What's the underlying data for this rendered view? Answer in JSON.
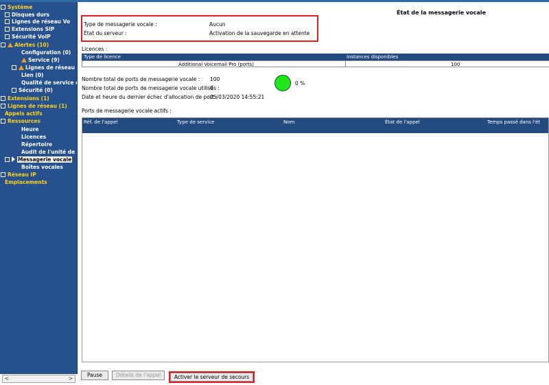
{
  "sidebar": {
    "items": [
      {
        "label": "Système",
        "color": "yellow",
        "expander": "minus"
      },
      {
        "label": "Disques durs",
        "color": "white",
        "expander": "plus"
      },
      {
        "label": "Lignes de réseau Vo",
        "color": "white",
        "expander": "plus"
      },
      {
        "label": "Extensions SIP",
        "color": "white",
        "expander": "plus"
      },
      {
        "label": "Sécurité VoIP",
        "color": "white",
        "expander": "plus"
      },
      {
        "label": "Alertes (10)",
        "color": "yellow",
        "expander": "minus",
        "icon": "warning-icon"
      },
      {
        "label": "Configuration (0)",
        "color": "white"
      },
      {
        "label": "Service (9)",
        "color": "white",
        "icon": "warning-icon"
      },
      {
        "label": "Lignes de réseau",
        "color": "white",
        "expander": "plus",
        "icon": "warning-icon"
      },
      {
        "label": "Lien (0)",
        "color": "white"
      },
      {
        "label": "Qualité de service de",
        "color": "white"
      },
      {
        "label": "Sécurité (0)",
        "color": "white",
        "expander": "plus"
      },
      {
        "label": "Extensions (1)",
        "color": "yellow",
        "expander": "plus"
      },
      {
        "label": "Lignes de réseau (1)",
        "color": "yellow",
        "expander": "plus"
      },
      {
        "label": "Appels actifs",
        "color": "yellow"
      },
      {
        "label": "Ressources",
        "color": "yellow",
        "expander": "minus"
      },
      {
        "label": "Heure",
        "color": "white"
      },
      {
        "label": "Licences",
        "color": "white"
      },
      {
        "label": "Répertoire",
        "color": "white"
      },
      {
        "label": "Audit de l'unité de c",
        "color": "white"
      },
      {
        "label": "Messagerie vocale",
        "color": "white",
        "expander": "minus",
        "selected": true,
        "icon": "arrow-icon"
      },
      {
        "label": "Boîtes vocales",
        "color": "white"
      },
      {
        "label": "Réseau IP",
        "color": "yellow",
        "expander": "plus"
      },
      {
        "label": "Emplacements",
        "color": "yellow"
      }
    ],
    "scroll_left": "<",
    "scroll_right": ">"
  },
  "main": {
    "title": "État de la messagerie vocale",
    "voicemail_type_label": "Type de messagerie vocale :",
    "voicemail_type_value": "Aucun",
    "server_state_label": "État du serveur :",
    "server_state_value": "Activation de la sauvegarde en attente",
    "licenses_label": "Licences :",
    "licenses_table": {
      "headers": [
        "Type de licence",
        "Instances disponibles"
      ],
      "rows": [
        [
          "Additional Voicemail Pro (ports)",
          "100"
        ]
      ]
    },
    "total_ports_label": "Nombre total de ports de messagerie vocale :",
    "total_ports_value": "100",
    "used_ports_label": "Nombre total de ports de messagerie vocale utilisés :",
    "used_ports_value": "0",
    "last_failure_label": "Date et heure du dernier échec d'allocation de port :",
    "last_failure_value": "25/03/2020 14:55:21",
    "usage_percent_text": "0 %",
    "usage_percent": 0,
    "active_ports_label": "Ports de messagerie vocale actifs :",
    "active_ports_headers": [
      "Réf. de l'appel",
      "Type de service",
      "Nom",
      "État de l'appel",
      "Temps passé dans l'ét"
    ],
    "active_ports_rows": []
  },
  "buttons": {
    "pause": "Pause",
    "call_details": "Détails de l'appel",
    "activate_backup": "Activer le serveur de secours"
  },
  "colors": {
    "sidebar_bg": "#26508e",
    "table_header_bg": "#244b7f",
    "highlight_red": "#e01b24",
    "gauge_green": "#1fe51a",
    "category_yellow": "#ffd21f"
  }
}
